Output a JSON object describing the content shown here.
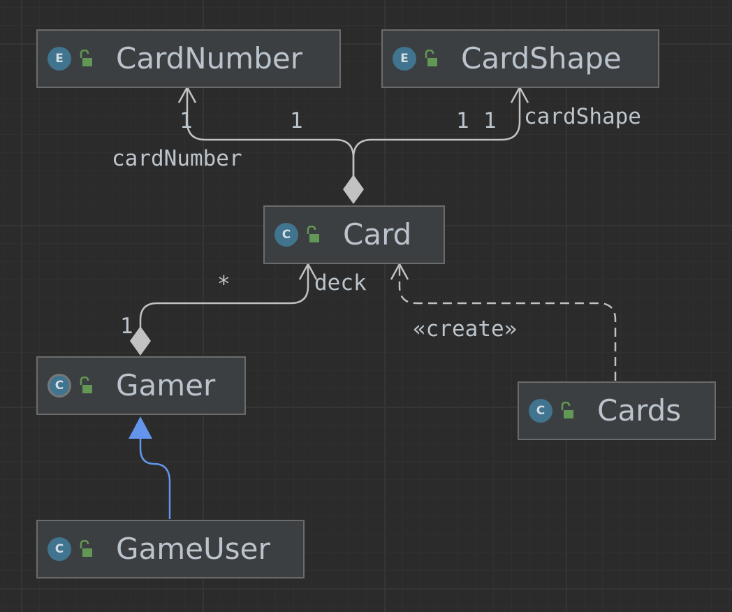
{
  "nodes": {
    "card_number": {
      "label": "CardNumber",
      "badge": "E",
      "kind": "enum"
    },
    "card_shape": {
      "label": "CardShape",
      "badge": "E",
      "kind": "enum"
    },
    "card": {
      "label": "Card",
      "badge": "C",
      "kind": "class"
    },
    "gamer": {
      "label": "Gamer",
      "badge": "C",
      "kind": "abstract class"
    },
    "cards": {
      "label": "Cards",
      "badge": "C",
      "kind": "class"
    },
    "game_user": {
      "label": "GameUser",
      "badge": "C",
      "kind": "class"
    }
  },
  "edges": {
    "card_to_card_number": {
      "type": "composition",
      "role": "cardNumber",
      "target_multiplicity": "1",
      "source_multiplicity": "1"
    },
    "card_to_card_shape": {
      "type": "composition",
      "role": "cardShape",
      "target_multiplicity": "1",
      "source_multiplicity": "1"
    },
    "gamer_to_card": {
      "type": "composition",
      "role": "deck",
      "target_multiplicity": "*",
      "source_multiplicity": "1"
    },
    "cards_to_card": {
      "type": "dependency",
      "stereotype": "«create»"
    },
    "game_user_to_gamer": {
      "type": "inheritance"
    }
  },
  "colors": {
    "background": "#2b2b2b",
    "node_fill": "#3c3f41",
    "node_border": "#6b6b6b",
    "edge": "#c2c2c2",
    "inheritance": "#6495ed",
    "badge": "#40748f",
    "lock": "#629755",
    "text": "#bbc3cc"
  },
  "icons": {
    "badge_icon": "circle-letter-icon",
    "visibility_icon": "open-lock-icon"
  }
}
